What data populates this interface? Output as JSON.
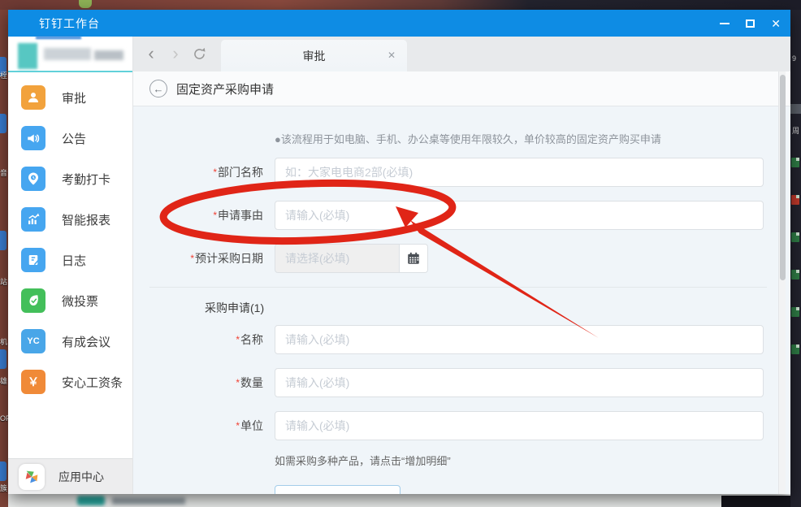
{
  "colors": {
    "titlebar": "#0e8ce4",
    "annotation": "#e02517"
  },
  "window": {
    "title": "钉钉工作台",
    "controls": {
      "minimize_name": "minimize",
      "maximize_name": "maximize",
      "close_glyph": "✕"
    }
  },
  "nav": {
    "back_glyph": "‹",
    "forward_glyph": "›"
  },
  "tab": {
    "label": "审批",
    "close_glyph": "✕"
  },
  "sidebar": {
    "items": [
      {
        "label": "审批",
        "color": "#f2a23c"
      },
      {
        "label": "公告",
        "color": "#46a6f0"
      },
      {
        "label": "考勤打卡",
        "color": "#46a6f0"
      },
      {
        "label": "智能报表",
        "color": "#46a6f0"
      },
      {
        "label": "日志",
        "color": "#46a6f0"
      },
      {
        "label": "微投票",
        "color": "#43bf5a",
        "glyph": "✔"
      },
      {
        "label": "有成会议",
        "color": "#49a6e8",
        "glyph": "YC"
      },
      {
        "label": "安心工资条",
        "color": "#f08a38",
        "glyph": "￥"
      }
    ],
    "footer_label": "应用中心"
  },
  "page": {
    "back_glyph": "←",
    "title": "固定资产采购申请",
    "description": "●该流程用于如电脑、手机、办公桌等使用年限较久，单价较高的固定资产购买申请",
    "required_mark": "*",
    "fields": {
      "department": {
        "label": "部门名称",
        "placeholder": "如：大家电电商2部(必填)"
      },
      "reason": {
        "label": "申请事由",
        "placeholder": "请输入(必填)"
      },
      "date": {
        "label": "预计采购日期",
        "placeholder": "请选择(必填)"
      }
    },
    "section": {
      "title": "采购申请(1)",
      "fields": {
        "name": {
          "label": "名称",
          "placeholder": "请输入(必填)"
        },
        "quantity": {
          "label": "数量",
          "placeholder": "请输入(必填)"
        },
        "unit": {
          "label": "单位",
          "placeholder": "请输入(必填)"
        }
      }
    },
    "note": "如需采购多种产品，请点击“增加明细”"
  },
  "desktop": {
    "right_texts": [
      "9",
      "周"
    ],
    "left_texts": [
      "桎",
      "音",
      "站",
      "机",
      "雄",
      "OF",
      "簇"
    ]
  }
}
